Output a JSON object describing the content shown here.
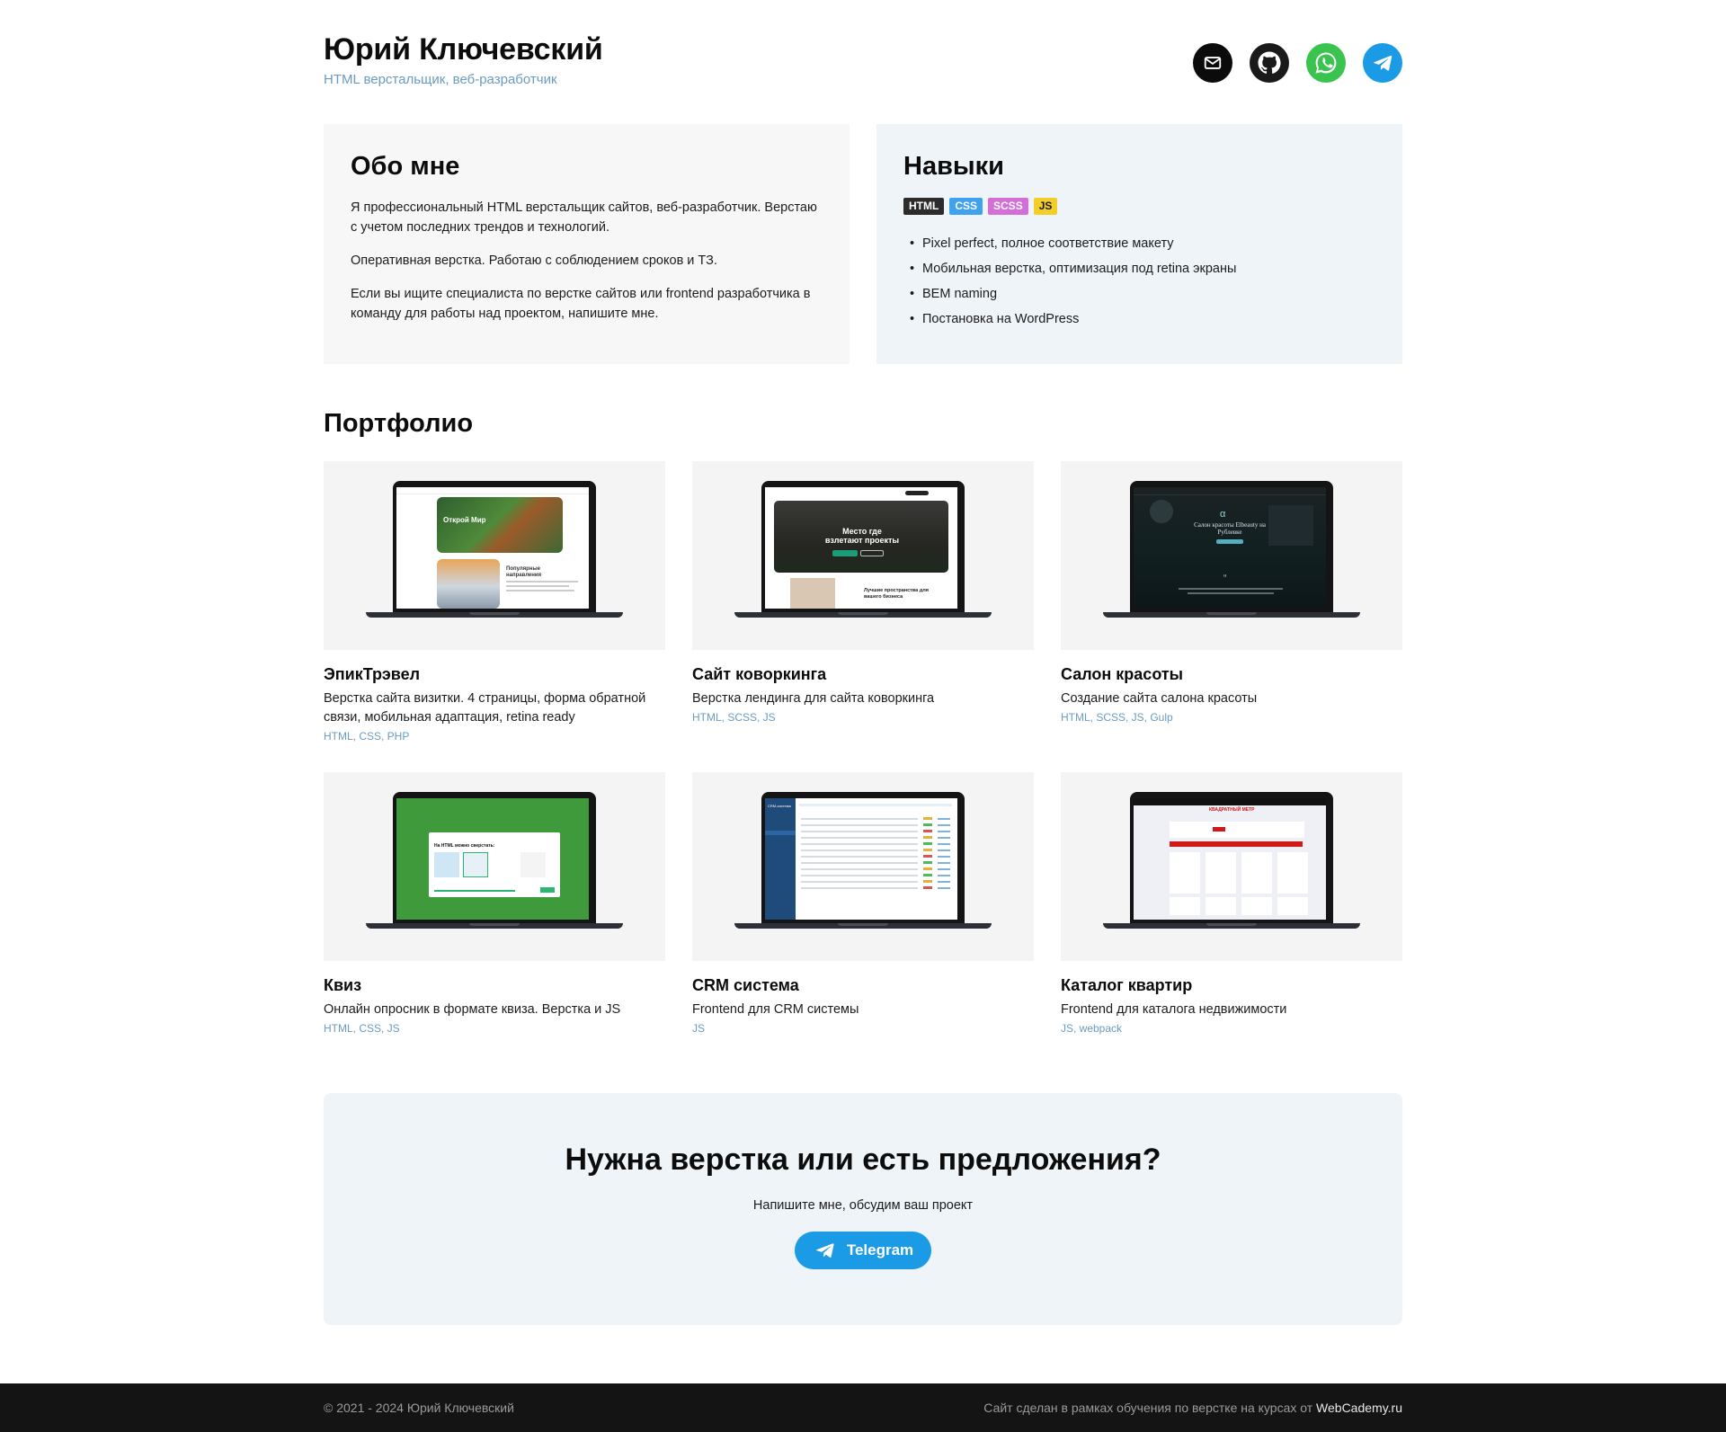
{
  "header": {
    "name": "Юрий Ключевский",
    "role": "HTML верстальщик, веб-разработчик",
    "socials": [
      {
        "icon": "mail-icon",
        "color": "#0b0b0b"
      },
      {
        "icon": "github-icon",
        "color": "#1a1a1a"
      },
      {
        "icon": "whatsapp-icon",
        "color": "#3ac34f"
      },
      {
        "icon": "telegram-icon",
        "color": "#1b9ae6"
      }
    ]
  },
  "about": {
    "title": "Обо мне",
    "paragraphs": [
      "Я профессиональный HTML верстальщик сайтов, веб-разработчик. Верстаю с учетом последних трендов и технологий.",
      "Оперативная верстка. Работаю с соблюдением сроков и ТЗ.",
      "Если вы ищите специалиста по верстке сайтов или frontend разработчика в команду для работы над проектом, напишите мне."
    ]
  },
  "skills": {
    "title": "Навыки",
    "badges": [
      {
        "label": "HTML",
        "bg": "#2c2c2c",
        "fg": "#ffffff"
      },
      {
        "label": "CSS",
        "bg": "#3fa2ef",
        "fg": "#ffffff"
      },
      {
        "label": "SCSS",
        "bg": "#d46fd8",
        "fg": "#ffffff"
      },
      {
        "label": "JS",
        "bg": "#f2cf28",
        "fg": "#1a1a1a"
      }
    ],
    "items": [
      "Pixel perfect, полное соответствие макету",
      "Мобильная верстка, оптимизация под retina экраны",
      "BEM naming",
      "Постановка на WordPress"
    ]
  },
  "portfolio": {
    "title": "Портфолио",
    "items": [
      {
        "title": "ЭпикТрэвел",
        "desc": "Верстка сайта визитки. 4 страницы, форма обратной связи, мобильная адаптация, retina ready",
        "tags": "HTML, CSS, PHP",
        "screen": "travel"
      },
      {
        "title": "Сайт коворкинга",
        "desc": "Верстка лендинга для сайта коворкинга",
        "tags": "HTML, SCSS, JS",
        "screen": "cowork"
      },
      {
        "title": "Салон красоты",
        "desc": "Создание сайта салона красоты",
        "tags": "HTML, SCSS, JS, Gulp",
        "screen": "salon"
      },
      {
        "title": "Квиз",
        "desc": "Онлайн опросник в формате квиза. Верстка и JS",
        "tags": "HTML, CSS, JS",
        "screen": "quiz"
      },
      {
        "title": "CRM система",
        "desc": "Frontend для CRM системы",
        "tags": "JS",
        "screen": "crm"
      },
      {
        "title": "Каталог квартир",
        "desc": "Frontend для каталога недвижимости",
        "tags": "JS, webpack",
        "screen": "catalog"
      }
    ]
  },
  "screens": {
    "travel_hero": "Открой Мир",
    "travel_section": "Популярные направления",
    "cowork_hero": "Место где взлетают проекты",
    "cowork_section": "Лучшие пространства для вашего бизнеса",
    "salon_hero": "Салон красоты Elbeauty на Рублевке",
    "quiz_question": "На HTML можно сверстать:",
    "crm_title": "CRM-система",
    "catalog_brand": "КВАДРАТНЫЙ МЕТР"
  },
  "cta": {
    "title": "Нужна верстка или есть предложения?",
    "subtitle": "Напишите мне, обсудим ваш проект",
    "button": "Telegram"
  },
  "footer": {
    "copyright": "© 2021 - 2024 Юрий Ключевский",
    "note": "Сайт сделан в рамках обучения по верстке на курсах от ",
    "link": "WebCademy.ru"
  }
}
